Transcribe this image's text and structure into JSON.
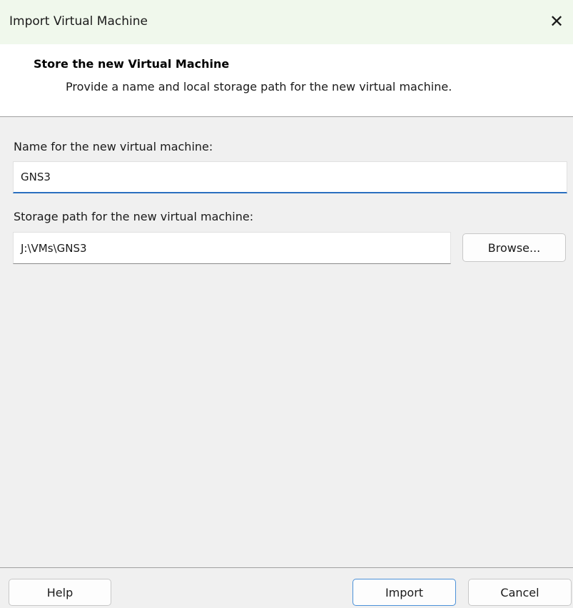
{
  "window": {
    "title": "Import Virtual Machine",
    "close_icon": "close-icon"
  },
  "header": {
    "heading": "Store the new Virtual Machine",
    "subtitle": "Provide a name and local storage path for the new virtual machine."
  },
  "form": {
    "name_label": "Name for the new virtual machine:",
    "name_value": "GNS3",
    "path_label": "Storage path for the new virtual machine:",
    "path_value": "J:\\VMs\\GNS3",
    "browse_label": "Browse..."
  },
  "footer": {
    "help_label": "Help",
    "import_label": "Import",
    "cancel_label": "Cancel"
  },
  "colors": {
    "titlebar_bg": "#f0f8ec",
    "accent": "#2a6fbf"
  }
}
